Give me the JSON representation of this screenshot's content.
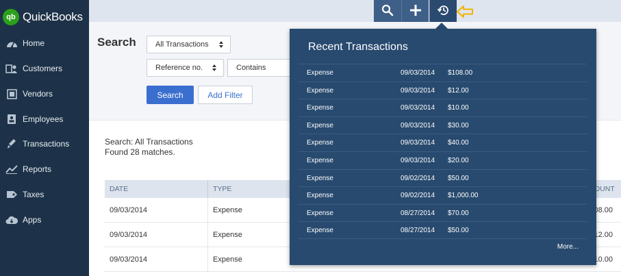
{
  "app": {
    "logo_mark": "qb",
    "logo_text": "QuickBooks"
  },
  "sidebar": {
    "items": [
      {
        "label": "Home",
        "icon": "dashboard-icon"
      },
      {
        "label": "Customers",
        "icon": "customers-icon"
      },
      {
        "label": "Vendors",
        "icon": "vendors-icon"
      },
      {
        "label": "Employees",
        "icon": "employees-icon"
      },
      {
        "label": "Transactions",
        "icon": "transactions-icon"
      },
      {
        "label": "Reports",
        "icon": "reports-icon"
      },
      {
        "label": "Taxes",
        "icon": "taxes-icon"
      },
      {
        "label": "Apps",
        "icon": "apps-icon"
      }
    ]
  },
  "topbar": {
    "buttons": [
      "search-icon",
      "plus-icon",
      "recent-transactions-icon"
    ],
    "active_button": "recent-transactions-icon",
    "annotation_color": "#f0b400"
  },
  "search": {
    "title": "Search",
    "type_select": "All Transactions",
    "field_select": "Reference no.",
    "operator_value": "Contains",
    "search_label": "Search",
    "add_filter_label": "Add Filter"
  },
  "results": {
    "summary_line1": "Search: All Transactions",
    "summary_line2": "Found 28 matches.",
    "columns": [
      "DATE",
      "TYPE",
      "OUNT"
    ],
    "rows": [
      {
        "date": "09/03/2014",
        "type": "Expense",
        "amount": "08.00"
      },
      {
        "date": "09/03/2014",
        "type": "Expense",
        "amount": "12.00"
      },
      {
        "date": "09/03/2014",
        "type": "Expense",
        "amount": "10.00"
      }
    ]
  },
  "recent": {
    "title": "Recent Transactions",
    "rows": [
      {
        "type": "Expense",
        "date": "09/03/2014",
        "amount": "$108.00"
      },
      {
        "type": "Expense",
        "date": "09/03/2014",
        "amount": "$12.00"
      },
      {
        "type": "Expense",
        "date": "09/03/2014",
        "amount": "$10.00"
      },
      {
        "type": "Expense",
        "date": "09/03/2014",
        "amount": "$30.00"
      },
      {
        "type": "Expense",
        "date": "09/03/2014",
        "amount": "$40.00"
      },
      {
        "type": "Expense",
        "date": "09/03/2014",
        "amount": "$20.00"
      },
      {
        "type": "Expense",
        "date": "09/02/2014",
        "amount": "$50.00"
      },
      {
        "type": "Expense",
        "date": "09/02/2014",
        "amount": "$1,000.00"
      },
      {
        "type": "Expense",
        "date": "08/27/2014",
        "amount": "$70.00"
      },
      {
        "type": "Expense",
        "date": "08/27/2014",
        "amount": "$50.00"
      }
    ],
    "more_label": "More..."
  },
  "colors": {
    "sidebar_bg": "#1d3248",
    "brand_green": "#2ca01c",
    "popover_bg": "#284a6f",
    "primary_button": "#3a6fcf"
  }
}
